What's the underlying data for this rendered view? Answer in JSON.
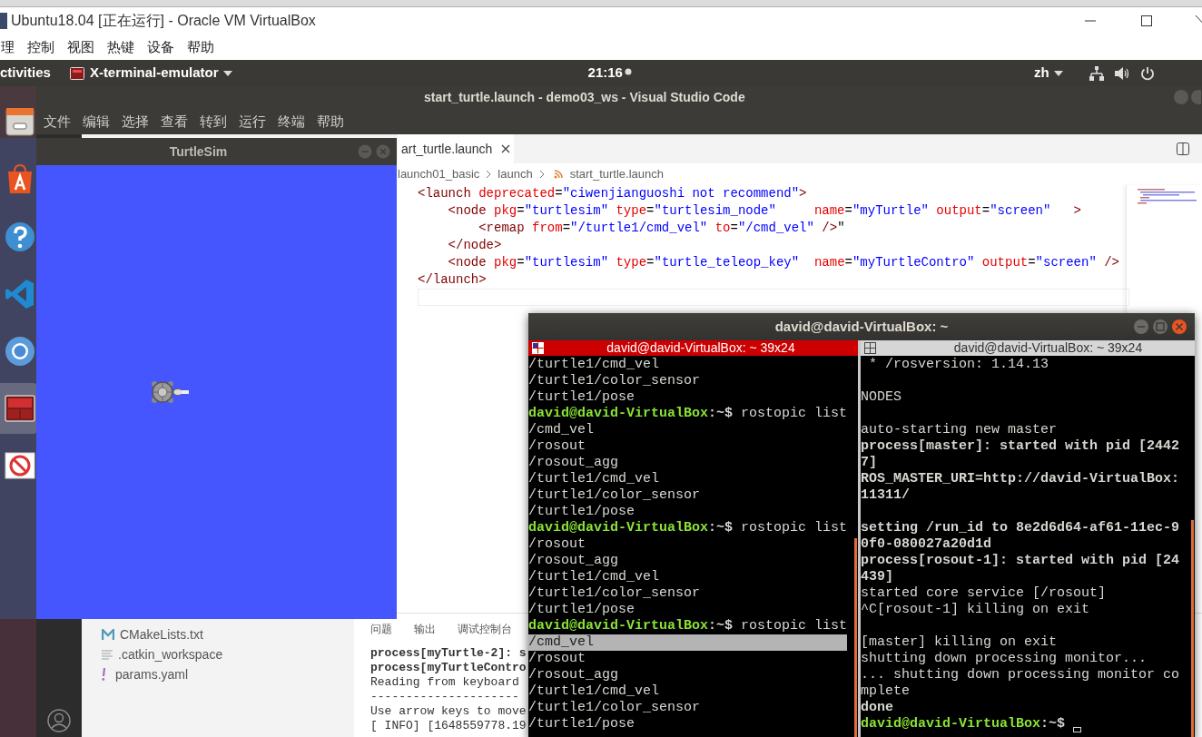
{
  "host_window": {
    "title": "Ubuntu18.04 [正在运行] - Oracle VM VirtualBox",
    "menu": [
      "理",
      "控制",
      "视图",
      "热键",
      "设备",
      "帮助"
    ]
  },
  "top_bar": {
    "activities": "ctivities",
    "app": "X-terminal-emulator",
    "clock": "21:16",
    "language": "zh"
  },
  "vscode": {
    "title": "start_turtle.launch - demo03_ws - Visual Studio Code",
    "menu": [
      "文件",
      "编辑",
      "选择",
      "查看",
      "转到",
      "运行",
      "终端",
      "帮助"
    ],
    "tab": {
      "label": "art_turtle.launch"
    },
    "breadcrumb": [
      "launch01_basic",
      "launch",
      "start_turtle.launch"
    ],
    "code": [
      [
        {
          "kind": "tag",
          "s": "<launch"
        },
        {
          "kind": "attr",
          "s": " deprecated"
        },
        {
          "kind": "plain",
          "s": "="
        },
        {
          "kind": "val",
          "s": "\"ciwenjianguoshi not recommend\""
        },
        {
          "kind": "tag",
          "s": ">"
        }
      ],
      [
        {
          "kind": "tag",
          "s": "    <node"
        },
        {
          "kind": "attr",
          "s": " pkg"
        },
        {
          "kind": "plain",
          "s": "="
        },
        {
          "kind": "val",
          "s": "\"turtlesim\""
        },
        {
          "kind": "attr",
          "s": " type"
        },
        {
          "kind": "plain",
          "s": "="
        },
        {
          "kind": "val",
          "s": "\"turtlesim_node\""
        },
        {
          "kind": "attr",
          "s": "     name"
        },
        {
          "kind": "plain",
          "s": "="
        },
        {
          "kind": "val",
          "s": "\"myTurtle\""
        },
        {
          "kind": "attr",
          "s": " output"
        },
        {
          "kind": "plain",
          "s": "="
        },
        {
          "kind": "val",
          "s": "\"screen\""
        },
        {
          "kind": "tag",
          "s": "   >"
        }
      ],
      [
        {
          "kind": "tag",
          "s": "        <remap"
        },
        {
          "kind": "attr",
          "s": " from"
        },
        {
          "kind": "plain",
          "s": "="
        },
        {
          "kind": "val",
          "s": "\"/turtle1/cmd_vel\""
        },
        {
          "kind": "attr",
          "s": " to"
        },
        {
          "kind": "plain",
          "s": "="
        },
        {
          "kind": "val",
          "s": "\"/cmd_vel\""
        },
        {
          "kind": "tag",
          "s": " />"
        },
        {
          "kind": "plain",
          "s": "\""
        }
      ],
      [
        {
          "kind": "tag",
          "s": "    </node>"
        }
      ],
      [
        {
          "kind": "tag",
          "s": "    <node"
        },
        {
          "kind": "attr",
          "s": " pkg"
        },
        {
          "kind": "plain",
          "s": "="
        },
        {
          "kind": "val",
          "s": "\"turtlesim\""
        },
        {
          "kind": "attr",
          "s": " type"
        },
        {
          "kind": "plain",
          "s": "="
        },
        {
          "kind": "val",
          "s": "\"turtle_teleop_key\""
        },
        {
          "kind": "attr",
          "s": "  name"
        },
        {
          "kind": "plain",
          "s": "="
        },
        {
          "kind": "val",
          "s": "\"myTurtleContro\""
        },
        {
          "kind": "attr",
          "s": " output"
        },
        {
          "kind": "plain",
          "s": "="
        },
        {
          "kind": "val",
          "s": "\"screen\""
        },
        {
          "kind": "tag",
          "s": " />"
        }
      ],
      [
        {
          "kind": "tag",
          "s": "</launch>"
        }
      ]
    ],
    "explorer": [
      {
        "kind": "cmake",
        "name": "CMakeLists.txt"
      },
      {
        "kind": "text",
        "name": ".catkin_workspace"
      },
      {
        "kind": "yaml",
        "name": "params.yaml"
      }
    ],
    "panel": {
      "tabs": [
        "问题",
        "输出",
        "调试控制台"
      ],
      "lines": [
        {
          "bold": true,
          "text": "process[myTurtle-2]: s"
        },
        {
          "bold": true,
          "text": "process[myTurtleContro"
        },
        {
          "bold": false,
          "text": "Reading from keyboard"
        },
        {
          "bold": false,
          "text": "---------------------"
        },
        {
          "bold": false,
          "text": "Use arrow keys to move"
        },
        {
          "bold": false,
          "text": "[ INFO] [1648559778.19"
        }
      ]
    }
  },
  "turtlesim": {
    "title": "TurtleSim"
  },
  "dock": [
    {
      "kind": "files",
      "active": false
    },
    {
      "kind": "store",
      "active": false
    },
    {
      "kind": "help",
      "active": false
    },
    {
      "kind": "vscode",
      "active": false
    },
    {
      "kind": "browser",
      "active": false
    },
    {
      "kind": "terminal",
      "active": true
    },
    {
      "kind": "blocked",
      "active": false
    }
  ],
  "terminal": {
    "title": "david@david-VirtualBox: ~",
    "panes": [
      {
        "title": "david@david-VirtualBox: ~ 39x24",
        "focused": true,
        "cursor": false,
        "lines": [
          {
            "kind": "text",
            "text": "/turtle1/cmd_vel",
            "selected": false
          },
          {
            "kind": "text",
            "text": "/turtle1/color_sensor",
            "selected": false
          },
          {
            "kind": "text",
            "text": "/turtle1/pose",
            "selected": false
          },
          {
            "kind": "prompt",
            "user": "david@david-VirtualBox",
            "rest": ":~$",
            "command": "rostopic list",
            "selected": false
          },
          {
            "kind": "text",
            "text": "/cmd_vel",
            "selected": false
          },
          {
            "kind": "text",
            "text": "/rosout",
            "selected": false
          },
          {
            "kind": "text",
            "text": "/rosout_agg",
            "selected": false
          },
          {
            "kind": "text",
            "text": "/turtle1/cmd_vel",
            "selected": false
          },
          {
            "kind": "text",
            "text": "/turtle1/color_sensor",
            "selected": false
          },
          {
            "kind": "text",
            "text": "/turtle1/pose",
            "selected": false
          },
          {
            "kind": "prompt",
            "user": "david@david-VirtualBox",
            "rest": ":~$",
            "command": "rostopic list",
            "selected": false
          },
          {
            "kind": "text",
            "text": "/rosout",
            "selected": false
          },
          {
            "kind": "text",
            "text": "/rosout_agg",
            "selected": false
          },
          {
            "kind": "text",
            "text": "/turtle1/cmd_vel",
            "selected": false
          },
          {
            "kind": "text",
            "text": "/turtle1/color_sensor",
            "selected": false
          },
          {
            "kind": "text",
            "text": "/turtle1/pose",
            "selected": false
          },
          {
            "kind": "prompt",
            "user": "david@david-VirtualBox",
            "rest": ":~$",
            "command": "rostopic list",
            "selected": false
          },
          {
            "kind": "text",
            "text": "/cmd_vel",
            "selected": true
          },
          {
            "kind": "text",
            "text": "/rosout",
            "selected": false
          },
          {
            "kind": "text",
            "text": "/rosout_agg",
            "selected": false
          },
          {
            "kind": "text",
            "text": "/turtle1/cmd_vel",
            "selected": false
          },
          {
            "kind": "text",
            "text": "/turtle1/color_sensor",
            "selected": false
          },
          {
            "kind": "text",
            "text": "/turtle1/pose",
            "selected": false
          }
        ]
      },
      {
        "title": "david@david-VirtualBox: ~ 39x24",
        "focused": false,
        "cursor": true,
        "lines": [
          {
            "kind": "text",
            "text": " * /rosversion: 1.14.13"
          },
          {
            "kind": "blank"
          },
          {
            "kind": "text",
            "text": "NODES"
          },
          {
            "kind": "blank"
          },
          {
            "kind": "text",
            "text": "auto-starting new master"
          },
          {
            "kind": "bold",
            "text": "process[master]: started with pid [2442"
          },
          {
            "kind": "bold",
            "text": "7]"
          },
          {
            "kind": "bold",
            "text": "ROS_MASTER_URI=http://david-VirtualBox:"
          },
          {
            "kind": "bold",
            "text": "11311/"
          },
          {
            "kind": "blank"
          },
          {
            "kind": "bold",
            "text": "setting /run_id to 8e2d6d64-af61-11ec-9"
          },
          {
            "kind": "bold",
            "text": "0f0-080027a20d1d"
          },
          {
            "kind": "bold",
            "text": "process[rosout-1]: started with pid [24"
          },
          {
            "kind": "bold",
            "text": "439]"
          },
          {
            "kind": "text",
            "text": "started core service [/rosout]"
          },
          {
            "kind": "text",
            "text": "^C[rosout-1] killing on exit"
          },
          {
            "kind": "blank"
          },
          {
            "kind": "text",
            "text": "[master] killing on exit"
          },
          {
            "kind": "text",
            "text": "shutting down processing monitor..."
          },
          {
            "kind": "text",
            "text": "... shutting down processing monitor co"
          },
          {
            "kind": "text",
            "text": "mplete"
          },
          {
            "kind": "bold",
            "text": "done"
          },
          {
            "kind": "prompt",
            "user": "david@david-VirtualBox",
            "rest": ":~$"
          }
        ]
      }
    ]
  }
}
